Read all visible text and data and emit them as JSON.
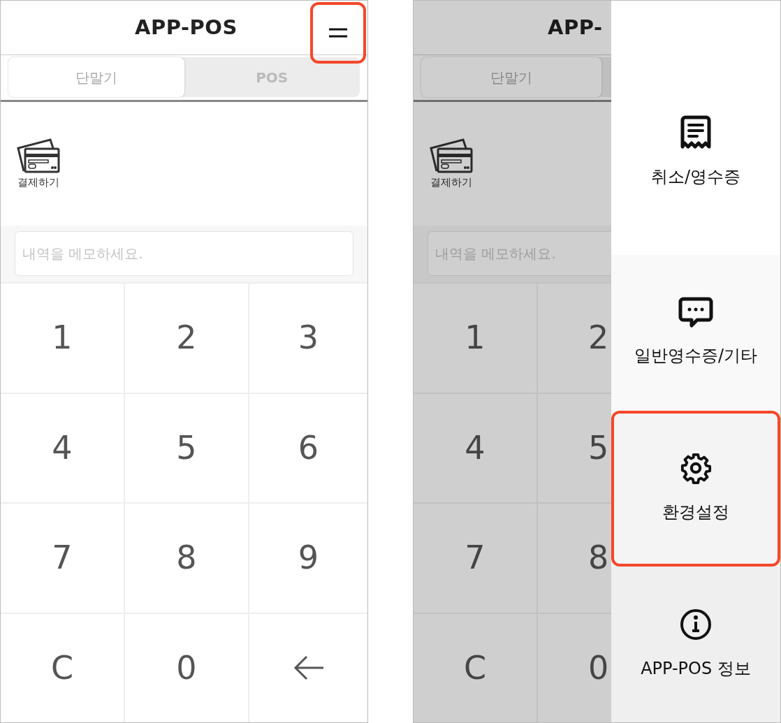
{
  "left_screen": {
    "title": "APP-POS",
    "menu_button": {
      "highlighted": true
    },
    "tabs": [
      {
        "label": "단말기",
        "selected": true
      },
      {
        "label": "POS",
        "selected": false
      }
    ],
    "pay_action": {
      "label": "결제하기"
    },
    "memo": {
      "placeholder": "내역을 메모하세요."
    },
    "keys": [
      {
        "kind": "digit",
        "label": "1"
      },
      {
        "kind": "digit",
        "label": "2"
      },
      {
        "kind": "digit",
        "label": "3"
      },
      {
        "kind": "digit",
        "label": "4"
      },
      {
        "kind": "digit",
        "label": "5"
      },
      {
        "kind": "digit",
        "label": "6"
      },
      {
        "kind": "digit",
        "label": "7"
      },
      {
        "kind": "digit",
        "label": "8"
      },
      {
        "kind": "digit",
        "label": "9"
      },
      {
        "kind": "digit",
        "label": "C"
      },
      {
        "kind": "digit",
        "label": "0"
      },
      {
        "kind": "back"
      }
    ]
  },
  "right_screen": {
    "title": "APP-",
    "tabs": [
      {
        "label": "단말기",
        "selected": true
      }
    ],
    "pay_action": {
      "label": "결제하기"
    },
    "memo": {
      "placeholder": "내역을 메모하세요."
    },
    "keys": [
      {
        "kind": "digit",
        "label": "1"
      },
      {
        "kind": "digit",
        "label": "2"
      },
      {
        "kind": "digit",
        "label": "4"
      },
      {
        "kind": "digit",
        "label": "5"
      },
      {
        "kind": "digit",
        "label": "7"
      },
      {
        "kind": "digit",
        "label": "8"
      },
      {
        "kind": "digit",
        "label": "C"
      },
      {
        "kind": "digit",
        "label": "0"
      }
    ],
    "drawer": {
      "items": [
        {
          "label": "취소/영수증",
          "highlighted": false
        },
        {
          "label": "일반영수증/기타",
          "highlighted": false
        },
        {
          "label": "환경설정",
          "highlighted": true
        },
        {
          "label": "APP-POS 정보",
          "highlighted": false
        }
      ]
    }
  }
}
